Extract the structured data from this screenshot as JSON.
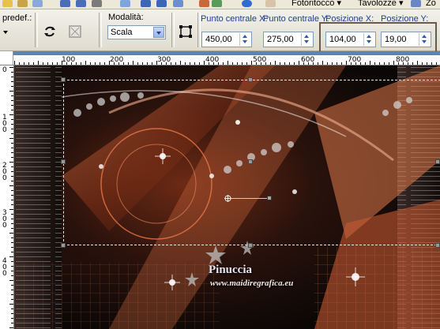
{
  "menubar": {
    "items": [
      {
        "label": "Fotoritocco",
        "name": "menu-fotoritocco"
      },
      {
        "label": "Tavolozze",
        "name": "menu-tavolozze"
      },
      {
        "label": "Zo",
        "name": "menu-zoom"
      }
    ]
  },
  "tool_options": {
    "preset_label": "predef.:",
    "mode_label": "Modalità:",
    "mode_value": "Scala",
    "center_x_label": "Punto centrale X:",
    "center_x_value": "450,00",
    "center_y_label": "Punto centrale Y:",
    "center_y_value": "275,00",
    "pos_x_label": "Posizione X:",
    "pos_x_value": "104,00",
    "pos_y_label": "Posizione Y:",
    "pos_y_value": "19,00"
  },
  "ruler_h": {
    "labels": [
      "100",
      "200",
      "300",
      "400",
      "500",
      "600",
      "700",
      "800"
    ]
  },
  "ruler_v": {
    "labels": [
      "0",
      "1\n0\n0",
      "2\n0\n0",
      "3\n0\n0",
      "4\n0\n0"
    ]
  },
  "canvas": {
    "watermark_name": "Pinuccia",
    "watermark_url": "www.maidiregrafica.eu"
  },
  "colors": {
    "accent_orange": "#e0643a",
    "background_dark": "#0e0908",
    "ruler_bar": "#5d82b8",
    "highlight_box": "#6b5a4c"
  }
}
